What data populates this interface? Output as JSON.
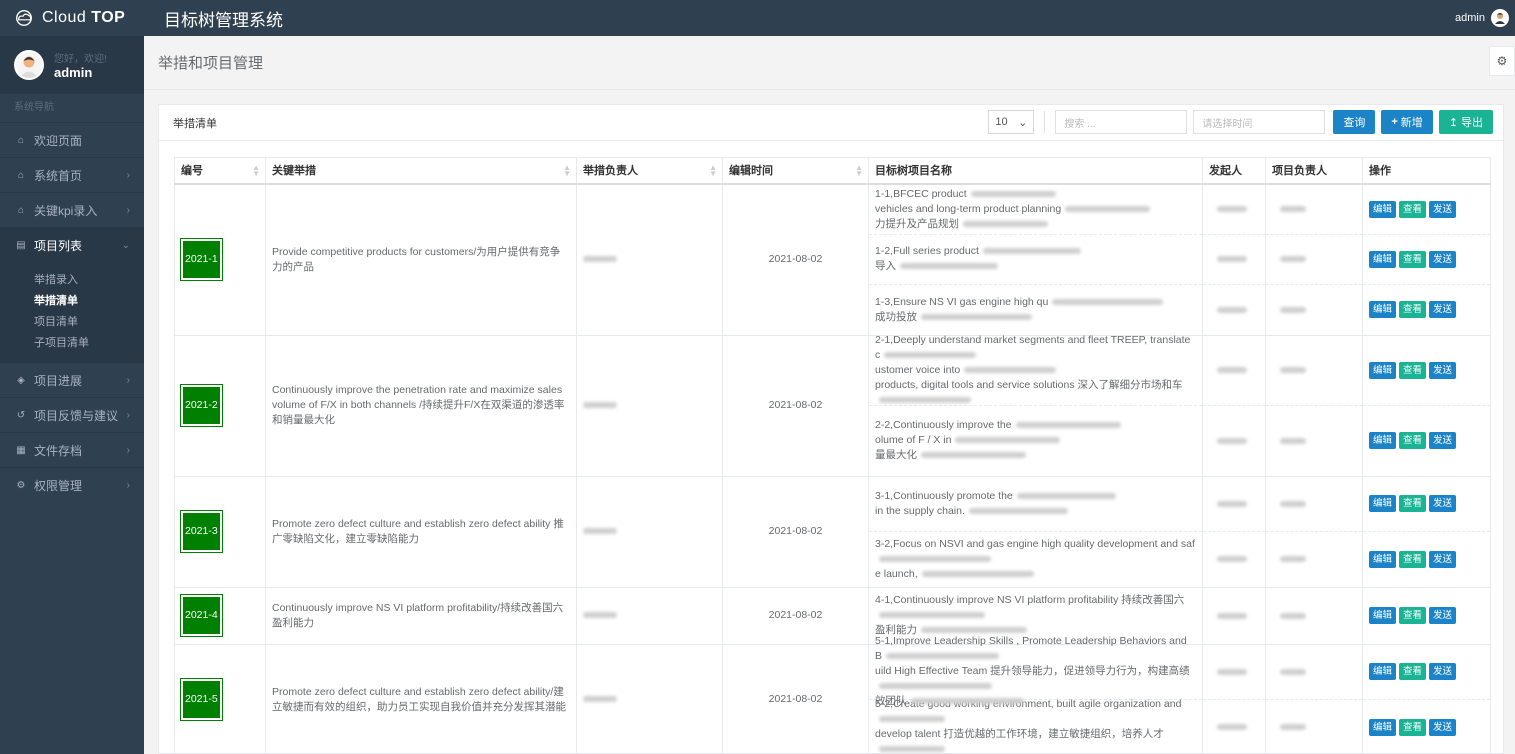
{
  "topbar": {
    "brand_prefix": "Cloud ",
    "brand_bold": "TOP",
    "system_title": "目标树管理系统",
    "user": "admin"
  },
  "sidebar": {
    "greeting": "您好，欢迎!",
    "username": "admin",
    "nav_title": "系统导航",
    "items": [
      {
        "label": "欢迎页面",
        "icon": "home-icon"
      },
      {
        "label": "系统首页",
        "icon": "home-icon"
      },
      {
        "label": "关键kpi录入",
        "icon": "home-icon"
      },
      {
        "label": "项目列表",
        "icon": "list-icon"
      },
      {
        "label": "项目进展",
        "icon": "cube-icon"
      },
      {
        "label": "项目反馈与建议",
        "icon": "history-icon"
      },
      {
        "label": "文件存档",
        "icon": "archive-icon"
      },
      {
        "label": "权限管理",
        "icon": "cogs-icon"
      }
    ],
    "subitems": [
      "举措录入",
      "举措清单",
      "项目清单",
      "子项目清单"
    ]
  },
  "page": {
    "title": "举措和项目管理"
  },
  "card": {
    "title": "举措清单",
    "page_size": "10",
    "search_placeholder": "搜索 ...",
    "date_placeholder": "请选择时间",
    "query_label": "查询",
    "add_label": "新增",
    "export_label": "导出"
  },
  "table": {
    "columns": [
      "编号",
      "关键举措",
      "举措负责人",
      "编辑时间",
      "目标树项目名称",
      "发起人",
      "项目负责人",
      "操作"
    ],
    "op_labels": {
      "edit": "编辑",
      "view": "查看",
      "send": "发送"
    },
    "rows": [
      {
        "code": "2021-1",
        "measure": "Provide competitive products for customers/为用户提供有竞争力的产品",
        "time": "2021-08-02",
        "projects": [
          {
            "line1": "1-1,BFCEC product",
            "line2": "vehicles and long-term product planning",
            "line3": "力提升及产品规划"
          },
          {
            "line1": "1-2,Full series product",
            "line2": "",
            "line3": "导入"
          },
          {
            "line1": "1-3,Ensure NS VI gas engine high qu",
            "line2": "",
            "line3": "成功投放"
          }
        ]
      },
      {
        "code": "2021-2",
        "measure": "Continuously improve the penetration rate and maximize sales volume of F/X in both channels /持续提升F/X在双渠道的渗透率和销量最大化",
        "time": "2021-08-02",
        "projects": [
          {
            "line1": "2-1,Deeply understand market segments and fleet TREEP, translate c",
            "line2": "ustomer voice into",
            "line3": "products, digital tools and service solutions 深入了解细分市场和车"
          },
          {
            "line1": "2-2,Continuously improve the",
            "line2": "olume of F / X in",
            "line3": "量最大化"
          }
        ]
      },
      {
        "code": "2021-3",
        "measure": "Promote zero defect culture and establish zero defect ability 推广零缺陷文化，建立零缺陷能力",
        "time": "2021-08-02",
        "projects": [
          {
            "line1": "3-1,Continuously promote the",
            "line2": "in the supply chain.",
            "line3": ""
          },
          {
            "line1": "3-2,Focus on NSVI and gas engine high quality development and saf",
            "line2": "e launch,",
            "line3": ""
          }
        ]
      },
      {
        "code": "2021-4",
        "measure": "Continuously improve NS VI platform profitability/持续改善国六盈利能力",
        "time": "2021-08-02",
        "projects": [
          {
            "line1": "4-1,Continuously improve NS VI platform profitability 持续改善国六",
            "line2": "盈利能力",
            "line3": ""
          }
        ]
      },
      {
        "code": "2021-5",
        "measure": "Promote zero defect culture and establish zero defect ability/建立敏捷而有效的组织，助力员工实现自我价值并充分发挥其潜能",
        "time": "2021-08-02",
        "projects": [
          {
            "line1": "5-1,Improve Leadership Skills , Promote Leadership Behaviors and B",
            "line2": "uild High Effective Team 提升领导能力，促进领导力行为，构建高绩",
            "line3": "效团队"
          },
          {
            "line1": "5-2,Create good working environment, built agile organization and",
            "line2": "develop talent 打造优越的工作环境，建立敏捷组织，培养人才",
            "line3": ""
          }
        ]
      }
    ]
  }
}
